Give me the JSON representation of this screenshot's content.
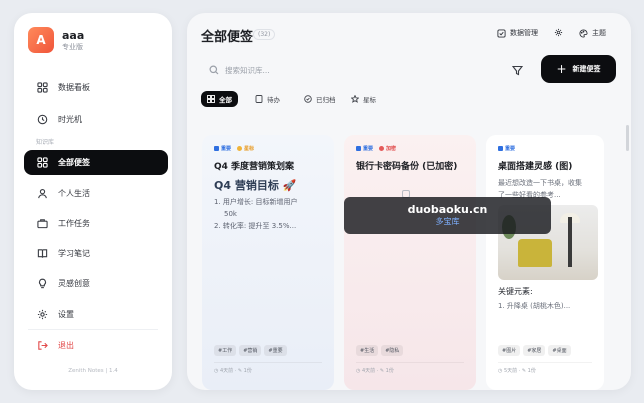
{
  "profile": {
    "avatar_letter": "A",
    "name": "aaa",
    "role": "专业版"
  },
  "sidebar": {
    "items": [
      {
        "label": "数据看板",
        "icon": "dashboard-icon"
      },
      {
        "label": "时光机",
        "icon": "history-icon"
      }
    ],
    "section_label": "知识库",
    "categories": [
      {
        "label": "全部便签",
        "icon": "grid-icon",
        "active": true
      },
      {
        "label": "个人生活",
        "icon": "user-icon"
      },
      {
        "label": "工作任务",
        "icon": "briefcase-icon"
      },
      {
        "label": "学习笔记",
        "icon": "book-icon"
      },
      {
        "label": "灵感创意",
        "icon": "lightbulb-icon"
      }
    ],
    "settings_label": "设置",
    "logout_label": "退出",
    "version": "Zenith Notes | 1.4"
  },
  "main": {
    "title": "全部便签",
    "count": "(32)",
    "actions": {
      "data_manage": "数据管理",
      "theme": "主题"
    },
    "search_placeholder": "搜索知识库...",
    "new_button": "新建便签",
    "filters": [
      "全部",
      "待办",
      "已归档",
      "星标"
    ]
  },
  "cards": [
    {
      "badges": [
        "重要",
        "星标"
      ],
      "title": "Q4 季度营销策划案",
      "subtitle": "Q4 营销目标 🚀",
      "lines": [
        "1. 用户增长: 目标新增用户",
        "50k",
        "2. 转化率: 提升至 3.5%..."
      ],
      "tags": [
        "#工作",
        "#营销",
        "#重要"
      ],
      "meta": "◷ 4天前 · ✎ 1份"
    },
    {
      "badges": [
        "重要",
        "加密"
      ],
      "title": "银行卡密码备份 (已加密)",
      "tags": [
        "#生活",
        "#隐私"
      ],
      "meta": "◷ 4天前 · ✎ 1份"
    },
    {
      "badges": [
        "重要"
      ],
      "title": "桌面搭建灵感 (图)",
      "lines": [
        "最近想改造一下书桌，收集",
        "了一些好看的参考..."
      ],
      "key_label": "关键元素:",
      "item": "1. 升降桌 (胡桃木色)...",
      "tags": [
        "#图片",
        "#家居",
        "#桌面"
      ],
      "meta": "◷ 5天前 · ✎ 1份"
    }
  ],
  "watermark": {
    "domain": "duobaoku.cn",
    "name": "多宝库"
  },
  "colors": {
    "accent": "#0c0d10",
    "avatar": "#f0553a",
    "danger": "#e24a4a",
    "link": "#2f6fe0"
  }
}
